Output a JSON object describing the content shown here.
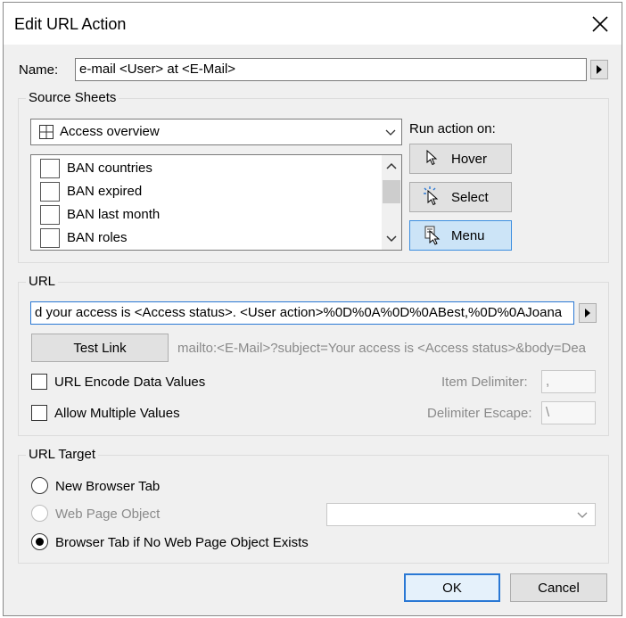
{
  "dialog": {
    "title": "Edit URL Action"
  },
  "name": {
    "label": "Name:",
    "value": "e-mail <User> at <E-Mail>"
  },
  "source_sheets": {
    "group_label": "Source Sheets",
    "selected_sheet": "Access overview",
    "run_action_label": "Run action on:",
    "hover_label": "Hover",
    "select_label": "Select",
    "menu_label": "Menu",
    "list_items": [
      {
        "label": "BAN countries",
        "checked": false
      },
      {
        "label": "BAN expired",
        "checked": false
      },
      {
        "label": "BAN last month",
        "checked": false
      },
      {
        "label": "BAN roles",
        "checked": false
      }
    ]
  },
  "url": {
    "group_label": "URL",
    "value": "d your access is <Access status>. <User action>%0D%0A%0D%0ABest,%0D%0AJoana",
    "test_link_label": "Test Link",
    "preview": "mailto:<E-Mail>?subject=Your access is <Access status>&body=Dea",
    "encode_label": "URL Encode Data Values",
    "multiple_label": "Allow Multiple Values",
    "item_delimiter_label": "Item Delimiter:",
    "item_delimiter_value": ",",
    "delimiter_escape_label": "Delimiter Escape:",
    "delimiter_escape_value": "\\"
  },
  "url_target": {
    "group_label": "URL Target",
    "options": [
      {
        "label": "New Browser Tab",
        "selected": false,
        "disabled": false
      },
      {
        "label": "Web Page Object",
        "selected": false,
        "disabled": true
      },
      {
        "label": "Browser Tab if No Web Page Object Exists",
        "selected": true,
        "disabled": false
      }
    ]
  },
  "footer": {
    "ok_label": "OK",
    "cancel_label": "Cancel"
  },
  "colors": {
    "accent": "#2a78d4",
    "menu_active_bg": "#cce4f7",
    "dialog_bg": "#f0f0f0"
  }
}
